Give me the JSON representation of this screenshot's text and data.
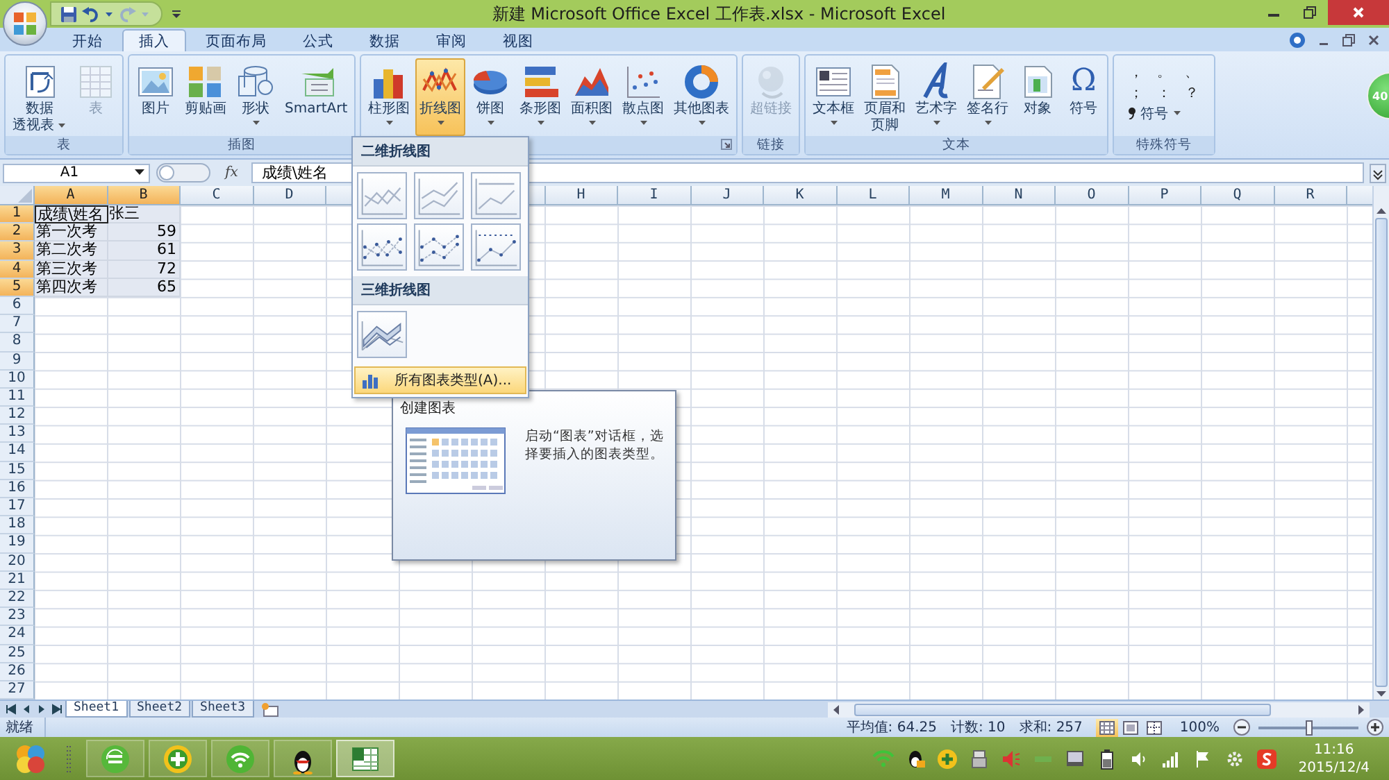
{
  "window": {
    "title": "新建 Microsoft Office Excel 工作表.xlsx - Microsoft Excel"
  },
  "tabs": [
    {
      "label": "开始",
      "selected": false
    },
    {
      "label": "插入",
      "selected": true
    },
    {
      "label": "页面布局",
      "selected": false
    },
    {
      "label": "公式",
      "selected": false
    },
    {
      "label": "数据",
      "selected": false
    },
    {
      "label": "审阅",
      "selected": false
    },
    {
      "label": "视图",
      "selected": false
    }
  ],
  "ribbon_groups": [
    {
      "kind": "buttons",
      "label": "表",
      "buttons": [
        {
          "lines": [
            "数据",
            "透视表"
          ],
          "dropdown": true,
          "selected": false,
          "disabled": false
        },
        {
          "lines": [
            "表"
          ],
          "dropdown": false,
          "selected": false,
          "disabled": true
        }
      ]
    },
    {
      "kind": "buttons",
      "label": "插图",
      "buttons": [
        {
          "lines": [
            "图片"
          ],
          "dropdown": false,
          "selected": false,
          "disabled": false
        },
        {
          "lines": [
            "剪贴画"
          ],
          "dropdown": false,
          "selected": false,
          "disabled": false
        },
        {
          "lines": [
            "形状"
          ],
          "dropdown": true,
          "selected": false,
          "disabled": false
        },
        {
          "lines": [
            "SmartArt"
          ],
          "dropdown": false,
          "selected": false,
          "disabled": false
        }
      ]
    },
    {
      "kind": "buttons",
      "launcher": true,
      "buttons": [
        {
          "lines": [
            "柱形图"
          ],
          "dropdown": true,
          "selected": false,
          "disabled": false
        },
        {
          "lines": [
            "折线图"
          ],
          "dropdown": true,
          "selected": true,
          "disabled": false
        },
        {
          "lines": [
            "饼图"
          ],
          "dropdown": true,
          "selected": false,
          "disabled": false
        },
        {
          "lines": [
            "条形图"
          ],
          "dropdown": true,
          "selected": false,
          "disabled": false
        },
        {
          "lines": [
            "面积图"
          ],
          "dropdown": true,
          "selected": false,
          "disabled": false
        },
        {
          "lines": [
            "散点图"
          ],
          "dropdown": true,
          "selected": false,
          "disabled": false
        },
        {
          "lines": [
            "其他图表"
          ],
          "dropdown": true,
          "selected": false,
          "disabled": false
        }
      ]
    },
    {
      "kind": "buttons",
      "label": "链接",
      "buttons": [
        {
          "lines": [
            "超链接"
          ],
          "dropdown": false,
          "selected": false,
          "disabled": true
        }
      ]
    },
    {
      "kind": "buttons",
      "label": "文本",
      "buttons": [
        {
          "lines": [
            "文本框"
          ],
          "dropdown": true,
          "selected": false,
          "disabled": false
        },
        {
          "lines": [
            "页眉和",
            "页脚"
          ],
          "dropdown": false,
          "selected": false,
          "disabled": false
        },
        {
          "lines": [
            "艺术字"
          ],
          "dropdown": true,
          "selected": false,
          "disabled": false
        },
        {
          "lines": [
            "签名行"
          ],
          "dropdown": true,
          "selected": false,
          "disabled": false
        },
        {
          "lines": [
            "对象"
          ],
          "dropdown": false,
          "selected": false,
          "disabled": false
        },
        {
          "lines": [
            "符号"
          ],
          "glyph": "Ω",
          "dropdown": false,
          "selected": false,
          "disabled": false
        }
      ]
    },
    {
      "kind": "symbols",
      "label": "特殊符号",
      "symbols": [
        "，",
        "。",
        "、",
        "；",
        "：",
        "？"
      ],
      "menu": "符号"
    }
  ],
  "floating_badge": {
    "text": "40"
  },
  "formula_bar": {
    "name_box": "A1",
    "function_label": "fx",
    "formula": "成绩\\姓名"
  },
  "sheet": {
    "columns": [
      {
        "label": "A",
        "selected": true
      },
      {
        "label": "B",
        "selected": true
      },
      {
        "label": "C",
        "selected": false
      },
      {
        "label": "D",
        "selected": false
      },
      {
        "selected": false
      },
      {},
      {
        "selected": false
      },
      {
        "label": "H",
        "selected": false
      },
      {
        "label": "I",
        "selected": false
      },
      {
        "label": "J",
        "selected": false
      },
      {
        "label": "K",
        "selected": false
      },
      {
        "label": "L",
        "selected": false
      },
      {
        "label": "M",
        "selected": false
      },
      {
        "label": "N",
        "selected": false
      },
      {
        "label": "O",
        "selected": false
      },
      {
        "label": "P",
        "selected": false
      },
      {
        "label": "Q",
        "selected": false
      },
      {
        "label": "R",
        "selected": false
      }
    ],
    "rows": [
      {
        "label": "1",
        "selected": true,
        "cells": [
          {
            "text": "成绩\\姓名",
            "kind": "text",
            "active": true,
            "selected": true
          },
          {
            "text": "张三",
            "kind": "text",
            "active": false,
            "selected": true
          }
        ]
      },
      {
        "label": "2",
        "selected": true,
        "cells": [
          {
            "text": "第一次考",
            "kind": "text",
            "active": false,
            "selected": true
          },
          {
            "text": "59",
            "kind": "number",
            "active": false,
            "selected": true
          }
        ]
      },
      {
        "label": "3",
        "selected": true,
        "cells": [
          {
            "text": "第二次考",
            "kind": "text",
            "active": false,
            "selected": true
          },
          {
            "text": "61",
            "kind": "number",
            "active": false,
            "selected": true
          }
        ]
      },
      {
        "label": "4",
        "selected": true,
        "cells": [
          {
            "text": "第三次考",
            "kind": "text",
            "active": false,
            "selected": true
          },
          {
            "text": "72",
            "kind": "number",
            "active": false,
            "selected": true
          }
        ]
      },
      {
        "label": "5",
        "selected": true,
        "cells": [
          {
            "text": "第四次考",
            "kind": "text",
            "active": false,
            "selected": true
          },
          {
            "text": "65",
            "kind": "number",
            "active": false,
            "selected": true
          }
        ]
      },
      {
        "label": "6",
        "selected": false
      },
      {
        "label": "7",
        "selected": false
      },
      {
        "label": "8",
        "selected": false
      },
      {
        "label": "9",
        "selected": false
      },
      {
        "label": "10",
        "selected": false
      },
      {
        "label": "11",
        "selected": false
      },
      {
        "label": "12",
        "selected": false
      },
      {
        "label": "13",
        "selected": false
      },
      {
        "label": "14",
        "selected": false
      },
      {
        "label": "15",
        "selected": false
      },
      {
        "label": "16",
        "selected": false
      },
      {
        "label": "17",
        "selected": false
      },
      {
        "label": "18",
        "selected": false
      },
      {
        "label": "19",
        "selected": false
      },
      {
        "label": "20",
        "selected": false
      },
      {
        "label": "21",
        "selected": false
      },
      {
        "label": "22",
        "selected": false
      },
      {
        "label": "23",
        "selected": false
      },
      {
        "label": "24",
        "selected": false
      },
      {
        "label": "25",
        "selected": false
      },
      {
        "label": "26",
        "selected": false
      },
      {
        "label": "27",
        "selected": false
      }
    ]
  },
  "chart_menu": {
    "sections": [
      {
        "title": "二维折线图",
        "charts": [
          {
            "kind": "line"
          },
          {
            "kind": "stacked"
          },
          {
            "kind": "percent"
          },
          {
            "kind": "line-markers"
          },
          {
            "kind": "stacked-markers"
          },
          {
            "kind": "percent-markers"
          }
        ]
      },
      {
        "title": "三维折线图",
        "charts": [
          {
            "kind": "perspective"
          }
        ]
      }
    ],
    "footer": {
      "label": "所有图表类型(A)...",
      "selected": true
    }
  },
  "tooltip": {
    "title": "创建图表",
    "text": "启动“图表”对话框，选择要插入的图表类型。"
  },
  "sheet_tabs": [
    {
      "label": "Sheet1",
      "selected": true
    },
    {
      "label": "Sheet2",
      "selected": false
    },
    {
      "label": "Sheet3",
      "selected": false
    }
  ],
  "status_bar": {
    "ready": "就绪",
    "stats": [
      "平均值: 64.25",
      "计数: 10",
      "求和: 257"
    ],
    "views": [
      {
        "selected": true
      },
      {
        "selected": false
      },
      {
        "selected": false
      }
    ],
    "zoom": "100%",
    "zoom_slider": {
      "level": 0.5
    }
  },
  "taskbar": {
    "apps": [
      {
        "selected": false
      },
      {
        "selected": false
      },
      {
        "selected": false
      },
      {
        "selected": false
      },
      {
        "selected": true
      }
    ],
    "clock": {
      "time": "11:16",
      "date": "2015/12/4"
    }
  }
}
